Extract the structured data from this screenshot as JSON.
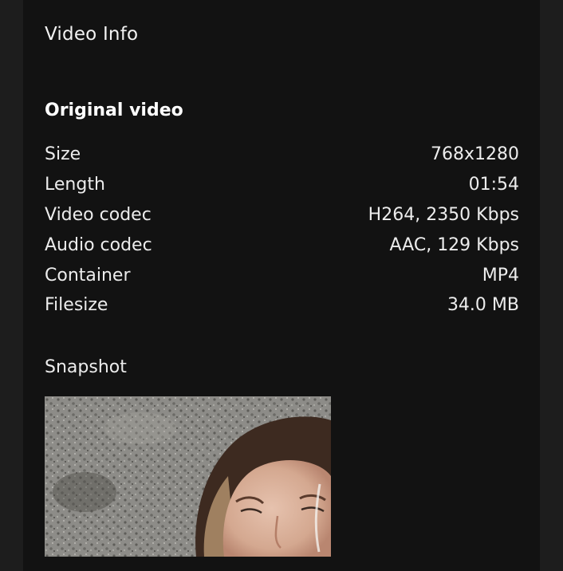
{
  "panel": {
    "heading": "Video Info",
    "section_title": "Original video",
    "rows": [
      {
        "label": "Size",
        "value": "768x1280"
      },
      {
        "label": "Length",
        "value": "01:54"
      },
      {
        "label": "Video codec",
        "value": "H264, 2350 Kbps"
      },
      {
        "label": "Audio codec",
        "value": "AAC, 129 Kbps"
      },
      {
        "label": "Container",
        "value": "MP4"
      },
      {
        "label": "Filesize",
        "value": "34.0 MB"
      }
    ],
    "snapshot_label": "Snapshot"
  },
  "colors": {
    "page_background": "#1d1d1d",
    "panel_background": "#121212",
    "text": "#ececec"
  }
}
